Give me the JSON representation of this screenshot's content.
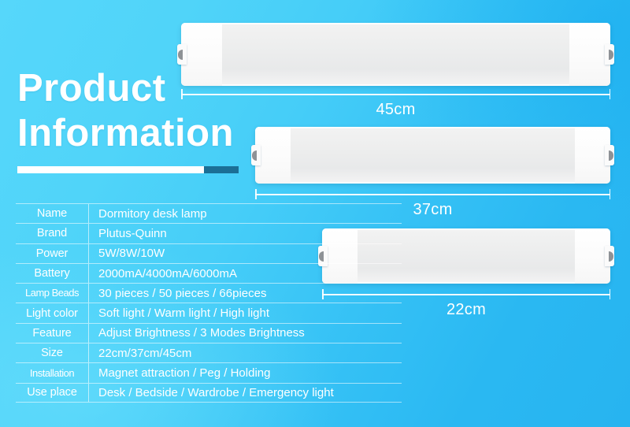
{
  "background": {
    "color_light": "#56d7fa",
    "color_dark": "#27b4f0"
  },
  "heading": {
    "line1": "Product",
    "line2": "Information",
    "accent_light_color": "#ffffff",
    "accent_dark_color": "#1b6f96"
  },
  "spec_table": {
    "rows": [
      {
        "key": "Name",
        "value": "Dormitory desk lamp"
      },
      {
        "key": "Brand",
        "value": "Plutus-Quinn"
      },
      {
        "key": "Power",
        "value": "5W/8W/10W"
      },
      {
        "key": "Battery",
        "value": "2000mA/4000mA/6000mA"
      },
      {
        "key": "Lamp Beads",
        "value": "30 pieces / 50 pieces / 66pieces"
      },
      {
        "key": "Light color",
        "value": "Soft light / Warm light / High light"
      },
      {
        "key": "Feature",
        "value": "Adjust Brightness / 3 Modes Brightness"
      },
      {
        "key": "Size",
        "value": "22cm/37cm/45cm"
      },
      {
        "key": "Installation",
        "value": "Magnet attraction / Peg / Holding"
      },
      {
        "key": "Use place",
        "value": "Desk / Bedside / Wardrobe / Emergency light"
      }
    ]
  },
  "products": [
    {
      "name": "lamp-45cm",
      "dimension_label": "45cm"
    },
    {
      "name": "lamp-37cm",
      "dimension_label": "37cm"
    },
    {
      "name": "lamp-22cm",
      "dimension_label": "22cm"
    }
  ]
}
